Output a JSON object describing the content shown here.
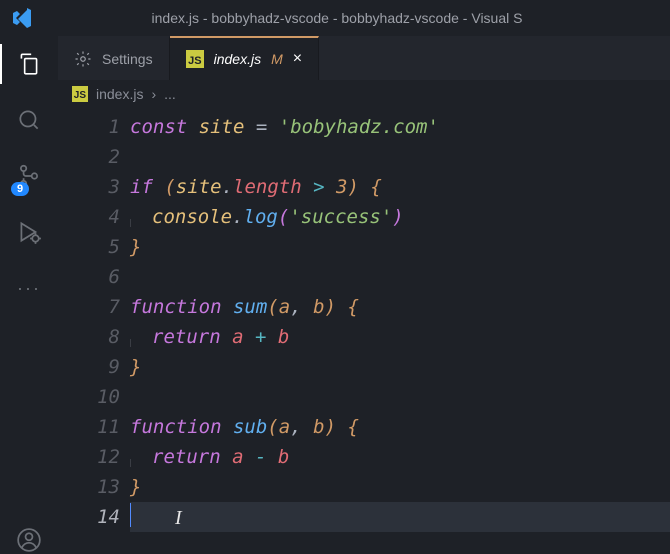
{
  "titlebar": {
    "title": "index.js - bobbyhadz-vscode - bobbyhadz-vscode - Visual S"
  },
  "activityBar": {
    "scmBadge": "9",
    "moreLabel": "···"
  },
  "tabs": [
    {
      "name": "Settings",
      "active": false
    },
    {
      "name": "index.js",
      "modified": "M",
      "active": true
    }
  ],
  "breadcrumb": {
    "file": "index.js",
    "sep": "›",
    "rest": "..."
  },
  "gutter": [
    "1",
    "2",
    "3",
    "4",
    "5",
    "6",
    "7",
    "8",
    "9",
    "10",
    "11",
    "12",
    "13",
    "14"
  ],
  "code": {
    "l1": {
      "kw": "const",
      "var": "site",
      "eq": "=",
      "str": "'bobyhadz.com'"
    },
    "l3": {
      "kw": "if",
      "lp": "(",
      "var": "site",
      "dot": ".",
      "prop": "length",
      "gt": ">",
      "num": "3",
      "rp": ")",
      "lb": "{"
    },
    "l4": {
      "obj": "console",
      "dot": ".",
      "fn": "log",
      "lp": "(",
      "str": "'success'",
      "rp": ")"
    },
    "l5": {
      "rb": "}"
    },
    "l7": {
      "kw": "function",
      "fn": "sum",
      "lp": "(",
      "a": "a",
      "c": ",",
      "b": "b",
      "rp": ")",
      "lb": "{"
    },
    "l8": {
      "kw": "return",
      "a": "a",
      "op": "+",
      "b": "b"
    },
    "l9": {
      "rb": "}"
    },
    "l11": {
      "kw": "function",
      "fn": "sub",
      "lp": "(",
      "a": "a",
      "c": ",",
      "b": "b",
      "rp": ")",
      "lb": "{"
    },
    "l12": {
      "kw": "return",
      "a": "a",
      "op": "-",
      "b": "b"
    },
    "l13": {
      "rb": "}"
    }
  }
}
